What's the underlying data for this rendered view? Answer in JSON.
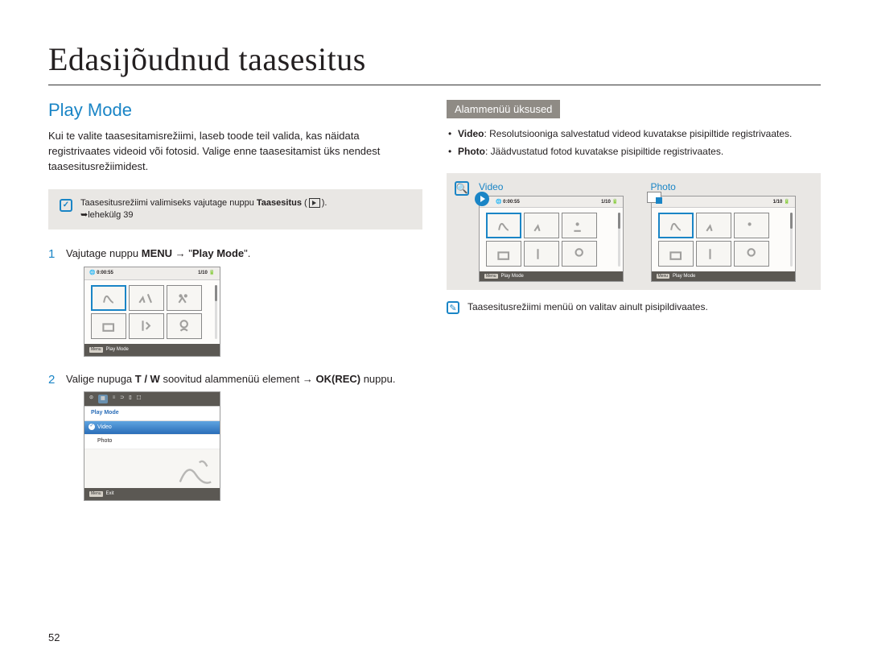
{
  "chapter_title": "Edasijõudnud taasesitus",
  "section_title": "Play Mode",
  "intro_text": "Kui te valite taasesitamisrežiimi, laseb toode teil valida, kas näidata registrivaates videoid või fotosid. Valige enne taasesitamist üks nendest taasesitusrežiimidest.",
  "note1_prefix": "Taasesitusrežiimi valimiseks vajutage nuppu ",
  "note1_bold": "Taasesitus",
  "note1_suffix": " (",
  "note1_pageref": "lehekülg 39",
  "step1_prefix": "Vajutage nuppu ",
  "step1_bold1": "MENU",
  "step1_arrow": " → \"",
  "step1_bold2": "Play Mode",
  "step1_suffix": "\".",
  "step2_prefix": "Valige nupuga ",
  "step2_bold1": "T / W",
  "step2_mid": " soovitud alammenüü element → ",
  "step2_bold2": "OK(REC)",
  "step2_suffix": " nuppu.",
  "screenshot": {
    "time": "0:00:55",
    "counter": "1/10",
    "footer_label": "Play Mode",
    "menu_chip": "Menu",
    "exit_label": "Exit"
  },
  "menu": {
    "title": "Play Mode",
    "item_video": "Video",
    "item_photo": "Photo"
  },
  "submenu_header": "Alammenüü üksused",
  "bullet_video_label": "Video",
  "bullet_video_text": ": Resolutsiooniga salvestatud videod kuvatakse pisipiltide registrivaates.",
  "bullet_photo_label": "Photo",
  "bullet_photo_text": ": Jäädvustatud fotod kuvatakse pisipiltide registrivaates.",
  "dual_labels": {
    "video": "Video",
    "photo": "Photo"
  },
  "final_note": "Taasesitusrežiimi menüü on valitav ainult pisipildivaates.",
  "page_number": "52"
}
